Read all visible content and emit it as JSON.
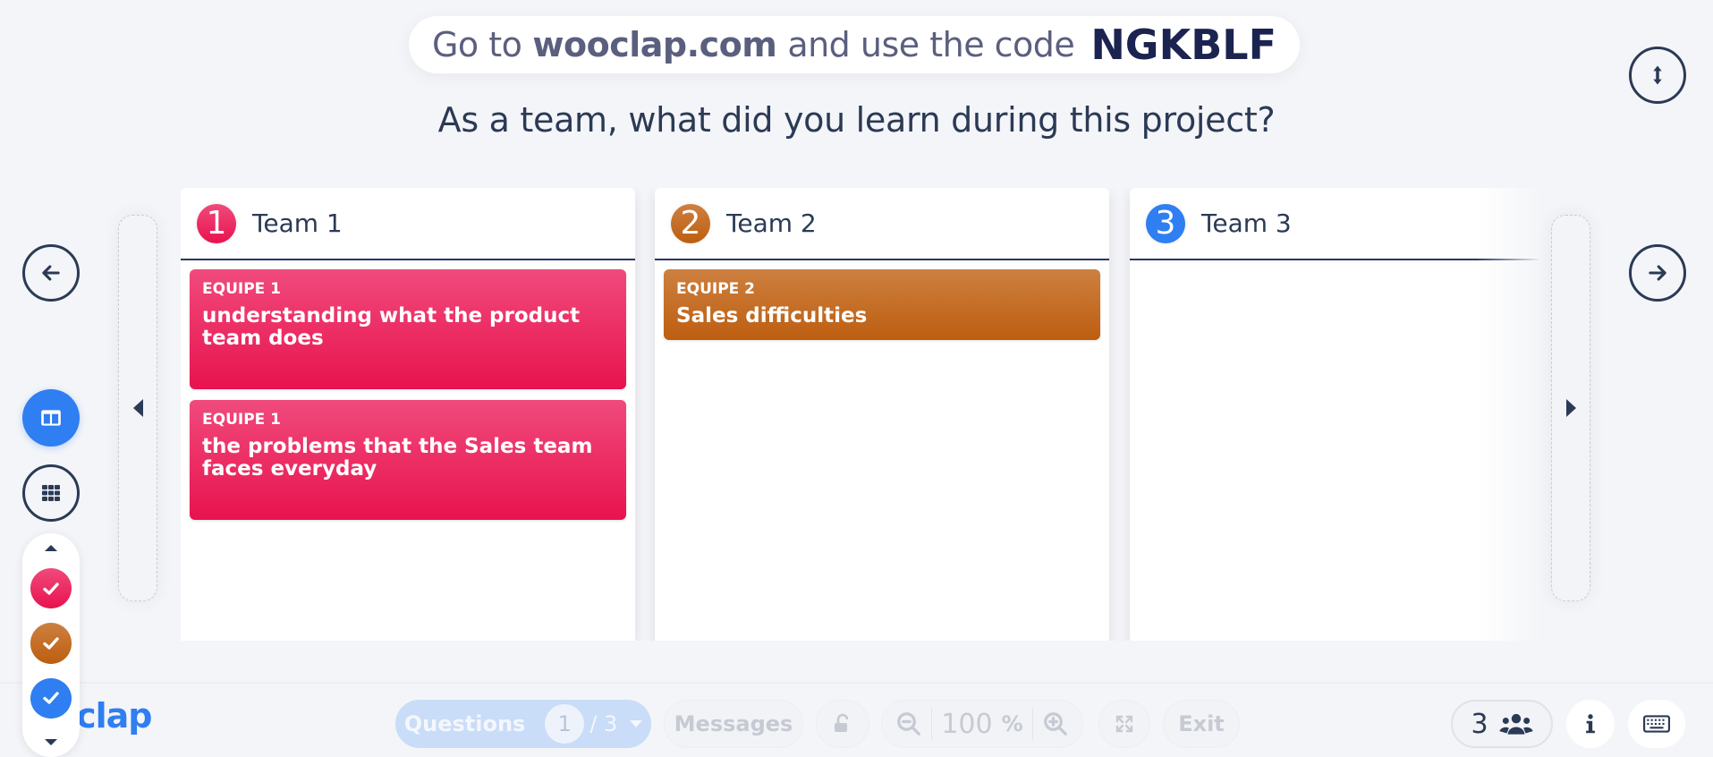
{
  "banner": {
    "prefix": "Go to",
    "site": "wooclap.com",
    "middle": "and use the code",
    "code": "NGKBLF"
  },
  "question": "As a team, what did you learn during this project?",
  "nav": {
    "previous_icon": "arrow-left-icon",
    "next_icon": "arrow-right-icon",
    "resize_icon": "vertical-resize-icon"
  },
  "columns": [
    {
      "number": "1",
      "title": "Team 1",
      "color": "#e8134e",
      "cards": [
        {
          "author": "EQUIPE 1",
          "text": "understanding what the product team does"
        },
        {
          "author": "EQUIPE 1",
          "text": "the problems that the Sales team faces everyday"
        }
      ]
    },
    {
      "number": "2",
      "title": "Team 2",
      "color": "#bd5e10",
      "cards": [
        {
          "author": "EQUIPE 2",
          "text": "Sales difficulties"
        }
      ]
    },
    {
      "number": "3",
      "title": "Team 3",
      "color": "#2f7ef2",
      "cards": []
    }
  ],
  "left_tools": {
    "column_view_icon": "columns-icon",
    "grid_view_icon": "grid-icon",
    "team_filters": [
      {
        "team": "Team 1",
        "color": "#e8134e",
        "checked": true
      },
      {
        "team": "Team 2",
        "color": "#bd5e10",
        "checked": true
      },
      {
        "team": "Team 3",
        "color": "#2f7ef2",
        "checked": true
      }
    ]
  },
  "bottombar": {
    "logo": "oclap",
    "questions_label": "Questions",
    "question_current": "1",
    "question_total": "/ 3",
    "messages_label": "Messages",
    "zoom_value": "100",
    "zoom_unit": "%",
    "exit_label": "Exit",
    "participants_count": "3"
  },
  "colors": {
    "accent": "#2f7ef2",
    "text": "#2b3a55",
    "background": "#f4f5f8"
  }
}
